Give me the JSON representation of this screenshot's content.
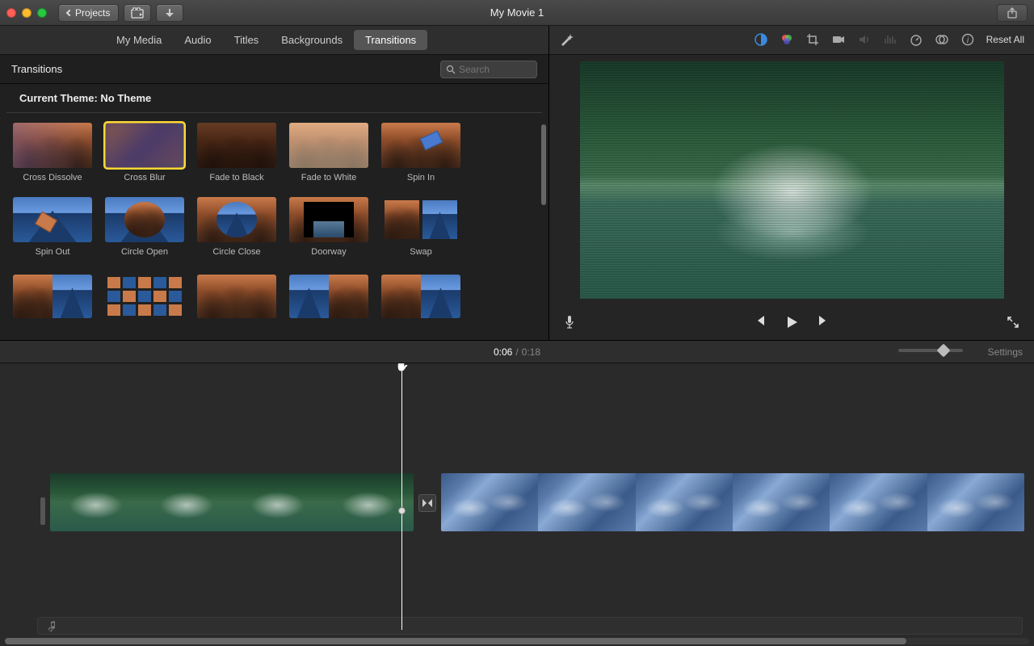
{
  "title": "My Movie 1",
  "toolbar": {
    "projects_label": "Projects"
  },
  "tabs": {
    "my_media": "My Media",
    "audio": "Audio",
    "titles": "Titles",
    "backgrounds": "Backgrounds",
    "transitions": "Transitions"
  },
  "panel": {
    "heading": "Transitions",
    "search_placeholder": "Search",
    "theme_label": "Current Theme: No Theme"
  },
  "transitions": [
    {
      "id": "cross-dissolve",
      "label": "Cross Dissolve"
    },
    {
      "id": "cross-blur",
      "label": "Cross Blur",
      "selected": true
    },
    {
      "id": "fade-to-black",
      "label": "Fade to Black"
    },
    {
      "id": "fade-to-white",
      "label": "Fade to White"
    },
    {
      "id": "spin-in",
      "label": "Spin In"
    },
    {
      "id": "spin-out",
      "label": "Spin Out"
    },
    {
      "id": "circle-open",
      "label": "Circle Open"
    },
    {
      "id": "circle-close",
      "label": "Circle Close"
    },
    {
      "id": "doorway",
      "label": "Doorway"
    },
    {
      "id": "swap",
      "label": "Swap"
    }
  ],
  "viewer": {
    "reset_label": "Reset All"
  },
  "time": {
    "current": "0:06",
    "total": "0:18",
    "settings_label": "Settings"
  }
}
